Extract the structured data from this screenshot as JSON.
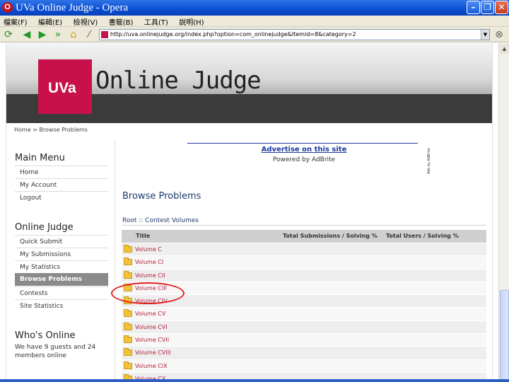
{
  "window": {
    "title": "UVa Online Judge - Opera"
  },
  "menubar": {
    "items": [
      "檔案(F)",
      "編輯(E)",
      "檢視(V)",
      "書籤(B)",
      "工具(T)",
      "說明(H)"
    ]
  },
  "toolbar": {
    "url": "http://uva.onlinejudge.org/index.php?option=com_onlinejudge&Itemid=8&category=2"
  },
  "header": {
    "logo": "UVa",
    "site_title": "Online Judge"
  },
  "breadcrumb": "Home > Browse Problems",
  "sidebar": {
    "main_menu_heading": "Main Menu",
    "main_menu": [
      "Home",
      "My Account",
      "Logout"
    ],
    "oj_heading": "Online Judge",
    "oj_items": [
      "Quick Submit",
      "My Submissions",
      "My Statistics",
      "Browse Problems",
      "Contests",
      "Site Statistics"
    ],
    "active_item": "Browse Problems",
    "whos_online_heading": "Who's Online",
    "whos_online_text": "We have 9 guests and 24 members online"
  },
  "ad": {
    "link": "Advertise on this site",
    "by": "Powered by AdBrite",
    "vertical": "Ads by AdBrite"
  },
  "content": {
    "title": "Browse Problems",
    "crumb": "Root :: Contest Volumes",
    "table": {
      "headers": [
        "Title",
        "Total Submissions / Solving %",
        "Total Users / Solving %"
      ],
      "rows": [
        "Volume C",
        "Volume CI",
        "Volume CII",
        "Volume CIII",
        "Volume CIV",
        "Volume CV",
        "Volume CVI",
        "Volume CVII",
        "Volume CVIII",
        "Volume CIX",
        "Volume CX"
      ]
    }
  },
  "annotation": {
    "color": "#e02020"
  }
}
